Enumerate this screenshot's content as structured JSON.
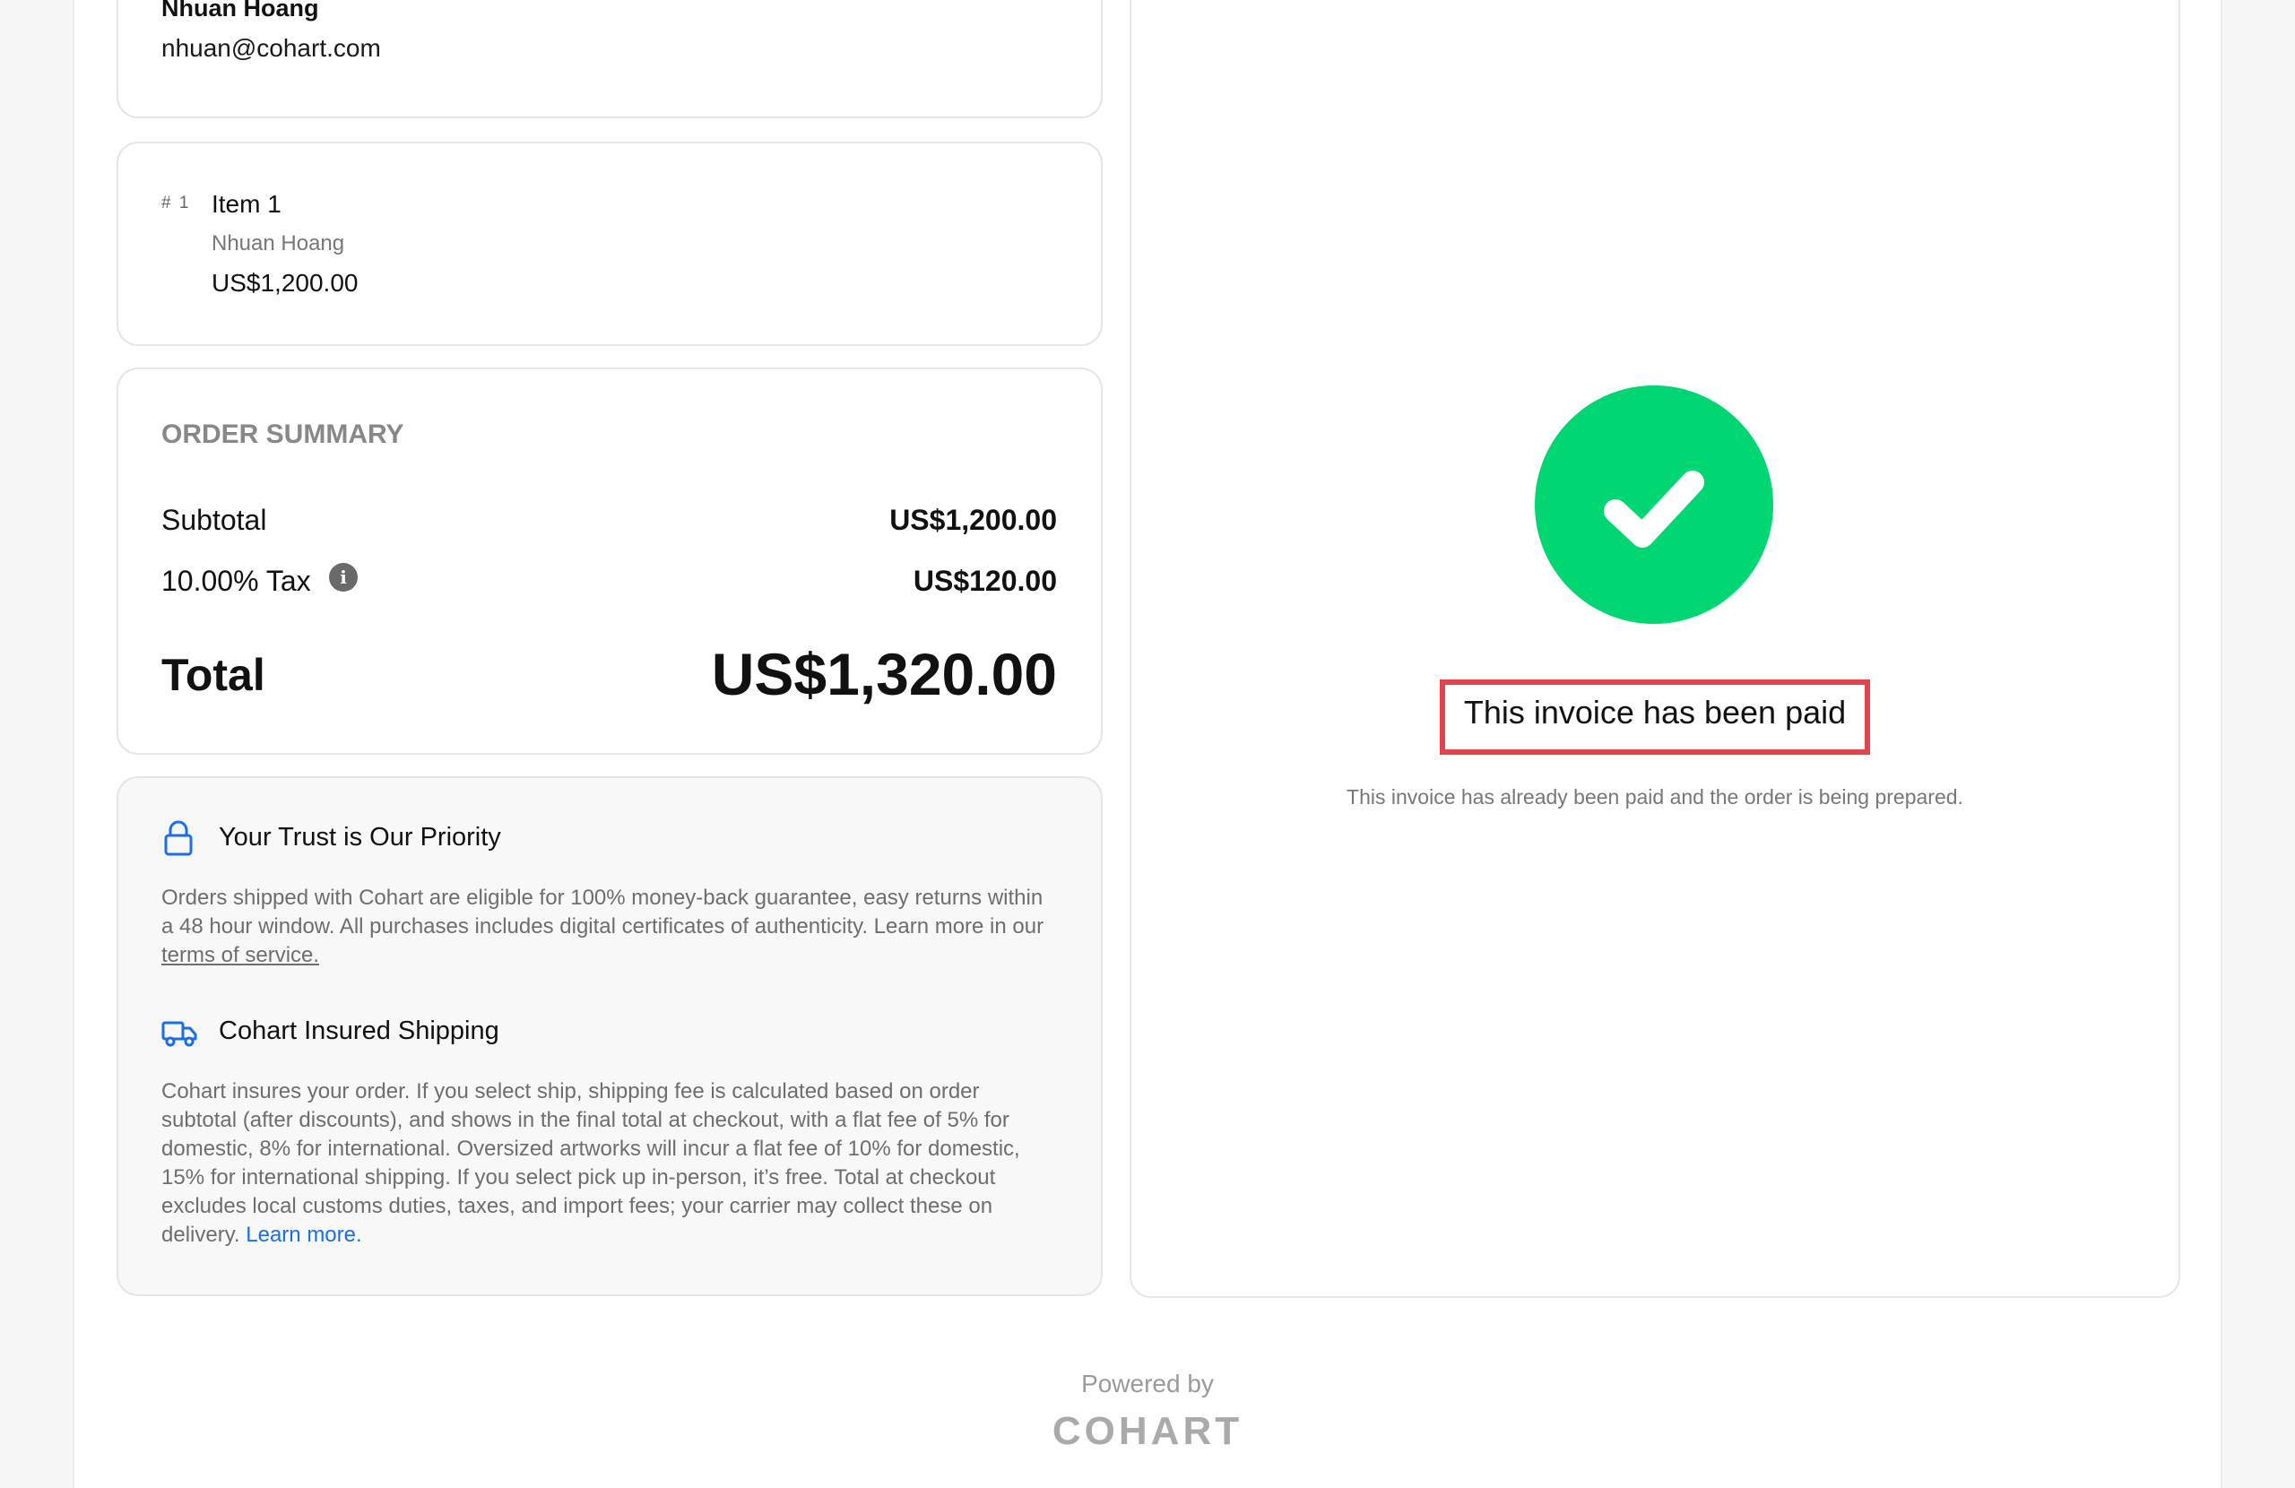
{
  "customer": {
    "name": "Nhuan Hoang",
    "email": "nhuan@cohart.com"
  },
  "item": {
    "index": "# 1",
    "title": "Item 1",
    "artist": "Nhuan Hoang",
    "price": "US$1,200.00"
  },
  "summary": {
    "heading": "ORDER SUMMARY",
    "subtotal_label": "Subtotal",
    "subtotal_value": "US$1,200.00",
    "tax_label": "10.00% Tax",
    "tax_value": "US$120.00",
    "info_icon": "info-icon",
    "total_label": "Total",
    "total_value": "US$1,320.00"
  },
  "trust": {
    "title": "Your Trust is Our Priority",
    "icon": "lock-icon",
    "body_prefix": "Orders shipped with Cohart are eligible for 100% money-back guarantee, easy returns within a 48 hour window. All purchases includes digital certificates of authenticity. Learn more in our ",
    "terms_link": "terms of service."
  },
  "shipping": {
    "title": "Cohart Insured Shipping",
    "icon": "truck-icon",
    "body_prefix": "Cohart insures your order. If you select ship, shipping fee is calculated based on order subtotal (after discounts), and shows in the final total at checkout, with a flat fee of 5% for domestic, 8% for international. Oversized artworks will incur a flat fee of 10% for domestic, 15% for international shipping. If you select pick up in-person, it’s free. Total at checkout excludes local customs duties, taxes, and import fees; your carrier may collect these on delivery. ",
    "learn_more": "Learn more."
  },
  "status": {
    "icon": "checkmark-icon",
    "title": "This invoice has been paid",
    "description": "This invoice has already been paid and the order is being prepared.",
    "success_color": "#00d672",
    "highlight_color": "#e2434d"
  },
  "footer": {
    "powered_by": "Powered by",
    "logo": "COHART"
  },
  "colors": {
    "link": "#1a6ee8",
    "muted_text": "#6e6e6e"
  }
}
